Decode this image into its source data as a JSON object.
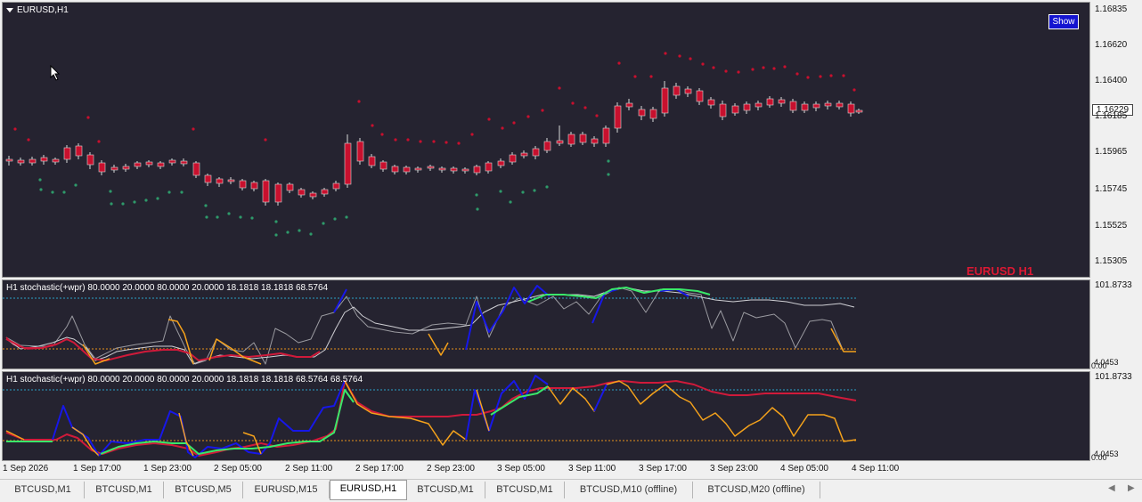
{
  "main": {
    "title": "EURUSD,H1",
    "show_button": "Show",
    "watermark": "EURUSD H1",
    "current_price": "1.16229",
    "price_labels": [
      "1.16835",
      "1.16620",
      "1.16400",
      "1.16185",
      "1.15965",
      "1.15745",
      "1.15525",
      "1.15305"
    ]
  },
  "indicator1": {
    "title": "H1 stochastic(+wpr) 80.0000 20.0000 80.0000 20.0000 18.1818 18.1818 68.5764",
    "axis_top": "101.8733",
    "axis_bottom_a": "4.0453",
    "axis_bottom_b": "0.00"
  },
  "indicator2": {
    "title": "H1 stochastic(+wpr) 80.0000 20.0000 80.0000 20.0000 18.1818 18.1818 68.5764 68.5764",
    "axis_top": "101.8733",
    "axis_bottom_a": "4.0453",
    "axis_bottom_b": "0.00"
  },
  "time_axis": [
    "1 Sep 2026",
    "1 Sep 17:00",
    "1 Sep 23:00",
    "2 Sep 05:00",
    "2 Sep 11:00",
    "2 Sep 17:00",
    "2 Sep 23:00",
    "3 Sep 05:00",
    "3 Sep 11:00",
    "3 Sep 17:00",
    "3 Sep 23:00",
    "4 Sep 05:00",
    "4 Sep 11:00"
  ],
  "tabs": [
    "BTCUSD,M1",
    "BTCUSD,M1",
    "BTCUSD,M5",
    "EURUSD,M15",
    "EURUSD,H1",
    "BTCUSD,M1",
    "BTCUSD,M1",
    "BTCUSD,M10 (offline)",
    "BTCUSD,M20 (offline)"
  ],
  "active_tab": "EURUSD,H1",
  "colors": {
    "background": "#252330",
    "bull": "#2e9a6a",
    "bear": "#c8102e",
    "upper_level": "#2aa0c8",
    "lower_level": "#e8901a",
    "blue": "#1717e8",
    "orange": "#f5a21b",
    "green": "#3ae86a",
    "red": "#d01a3a"
  }
}
